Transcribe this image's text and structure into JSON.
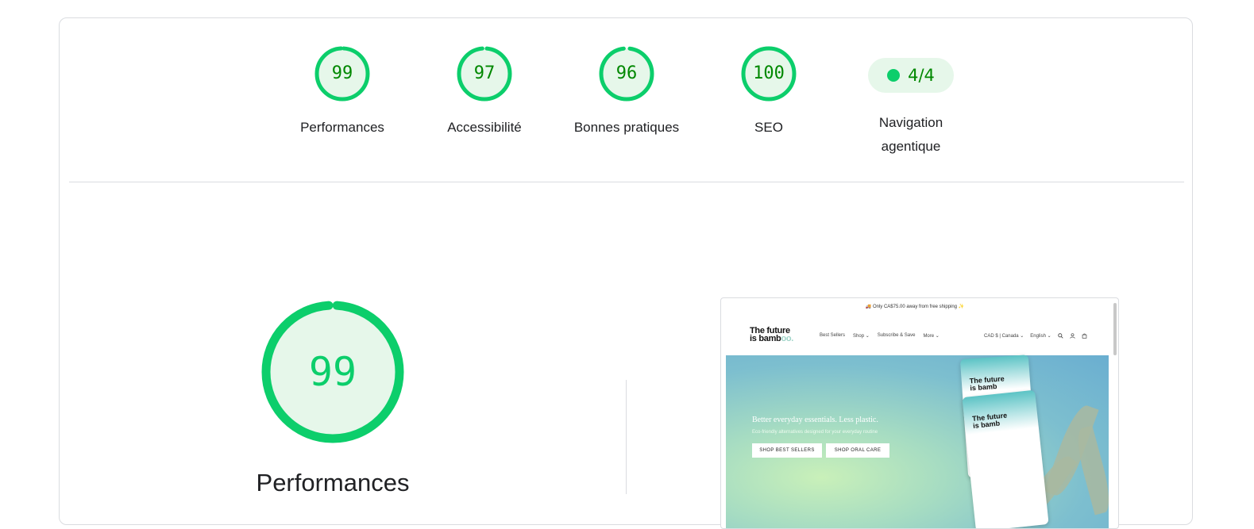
{
  "gauges": [
    {
      "label": "Performances",
      "score": "99",
      "value": 99
    },
    {
      "label": "Accessibilité",
      "score": "97",
      "value": 97
    },
    {
      "label": "Bonnes pratiques",
      "score": "96",
      "value": 96
    },
    {
      "label": "SEO",
      "score": "100",
      "value": 100
    }
  ],
  "agentic": {
    "label_line1": "Navigation",
    "label_line2": "agentique",
    "value": "4/4"
  },
  "main": {
    "score": "99",
    "value": 99,
    "title": "Performances"
  },
  "preview": {
    "announcement": "🚚 Only CA$75.00 away from free shipping ✨",
    "logo_line1": "The future",
    "logo_line2": "is bamb",
    "logo_tail": "oo.",
    "nav": [
      "Best Sellers",
      "Shop ⌄",
      "Subscribe & Save",
      "More ⌄"
    ],
    "currency": "CAD $ | Canada ⌄",
    "language": "English ⌄",
    "hero_title": "Better everyday essentials. Less plastic.",
    "hero_subtitle": "Eco-friendly alternatives designed for your everyday routine",
    "btn_best_sellers": "SHOP BEST SELLERS",
    "btn_oral_care": "SHOP ORAL CARE",
    "pack_title_line1": "The future",
    "pack_title_line2": "is bamb"
  },
  "colors": {
    "pass_green": "#0cce6b",
    "pass_text": "#008800",
    "pass_fill": "#e6f7ea"
  },
  "icons": [
    "search-icon",
    "account-icon",
    "cart-icon"
  ]
}
